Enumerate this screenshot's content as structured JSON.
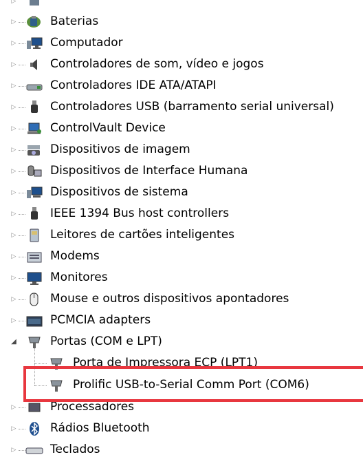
{
  "device_tree": {
    "items": [
      {
        "label": "Baterias",
        "icon": "battery-icon",
        "expanded": false
      },
      {
        "label": "Computador",
        "icon": "computer-icon",
        "expanded": false
      },
      {
        "label": "Controladores de som, vídeo e jogos",
        "icon": "speaker-icon",
        "expanded": false
      },
      {
        "label": "Controladores IDE ATA/ATAPI",
        "icon": "ide-controller-icon",
        "expanded": false
      },
      {
        "label": "Controladores USB (barramento serial universal)",
        "icon": "usb-plug-icon",
        "expanded": false
      },
      {
        "label": "ControlVault Device",
        "icon": "controlvault-icon",
        "expanded": false
      },
      {
        "label": "Dispositivos de imagem",
        "icon": "camera-icon",
        "expanded": false
      },
      {
        "label": "Dispositivos de Interface Humana",
        "icon": "hid-icon",
        "expanded": false
      },
      {
        "label": "Dispositivos de sistema",
        "icon": "system-device-icon",
        "expanded": false
      },
      {
        "label": "IEEE 1394 Bus host controllers",
        "icon": "firewire-icon",
        "expanded": false
      },
      {
        "label": "Leitores de cartões inteligentes",
        "icon": "smartcard-reader-icon",
        "expanded": false
      },
      {
        "label": "Modems",
        "icon": "modem-icon",
        "expanded": false
      },
      {
        "label": "Monitores",
        "icon": "monitor-icon",
        "expanded": false
      },
      {
        "label": "Mouse e outros dispositivos apontadores",
        "icon": "mouse-icon",
        "expanded": false
      },
      {
        "label": "PCMCIA adapters",
        "icon": "pcmcia-icon",
        "expanded": false
      },
      {
        "label": "Portas (COM e LPT)",
        "icon": "port-icon",
        "expanded": true,
        "children": [
          {
            "label": "Porta de Impressora ECP (LPT1)",
            "icon": "port-icon"
          },
          {
            "label": "Prolific USB-to-Serial Comm Port (COM6)",
            "icon": "port-icon",
            "highlighted": true
          }
        ]
      },
      {
        "label": "Processadores",
        "icon": "processor-icon",
        "expanded": false
      },
      {
        "label": "Rádios Bluetooth",
        "icon": "bluetooth-icon",
        "expanded": false
      },
      {
        "label": "Teclados",
        "icon": "keyboard-icon",
        "expanded": false
      }
    ]
  },
  "highlight_color": "#e8373f"
}
